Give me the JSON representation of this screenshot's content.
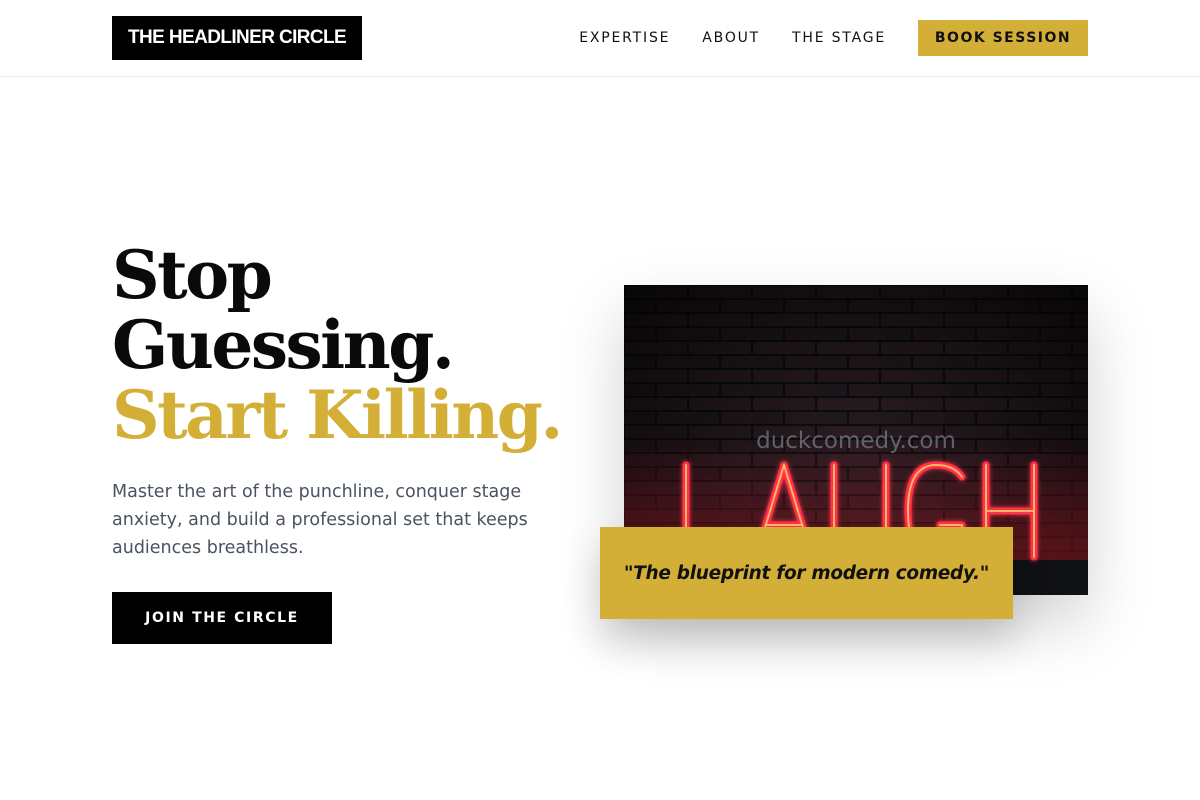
{
  "header": {
    "logo": "THE HEADLINER CIRCLE",
    "nav": [
      "EXPERTISE",
      "ABOUT",
      "THE STAGE"
    ],
    "cta": "BOOK SESSION"
  },
  "hero": {
    "headline_line1": "Stop",
    "headline_line2": "Guessing.",
    "headline_line3": "Start Killing.",
    "lead": "Master the art of the punchline, conquer stage anxiety, and build a professional set that keeps audiences breathless.",
    "button": "JOIN THE CIRCLE"
  },
  "image": {
    "neon_sign": "LAUGH",
    "watermark": "duckcomedy.com"
  },
  "quote": "\"The blueprint for modern comedy.\"",
  "colors": {
    "accent": "#d4af37",
    "dark": "#000000",
    "body_text": "#4a5360",
    "neon_red": "#ff2a3a"
  }
}
